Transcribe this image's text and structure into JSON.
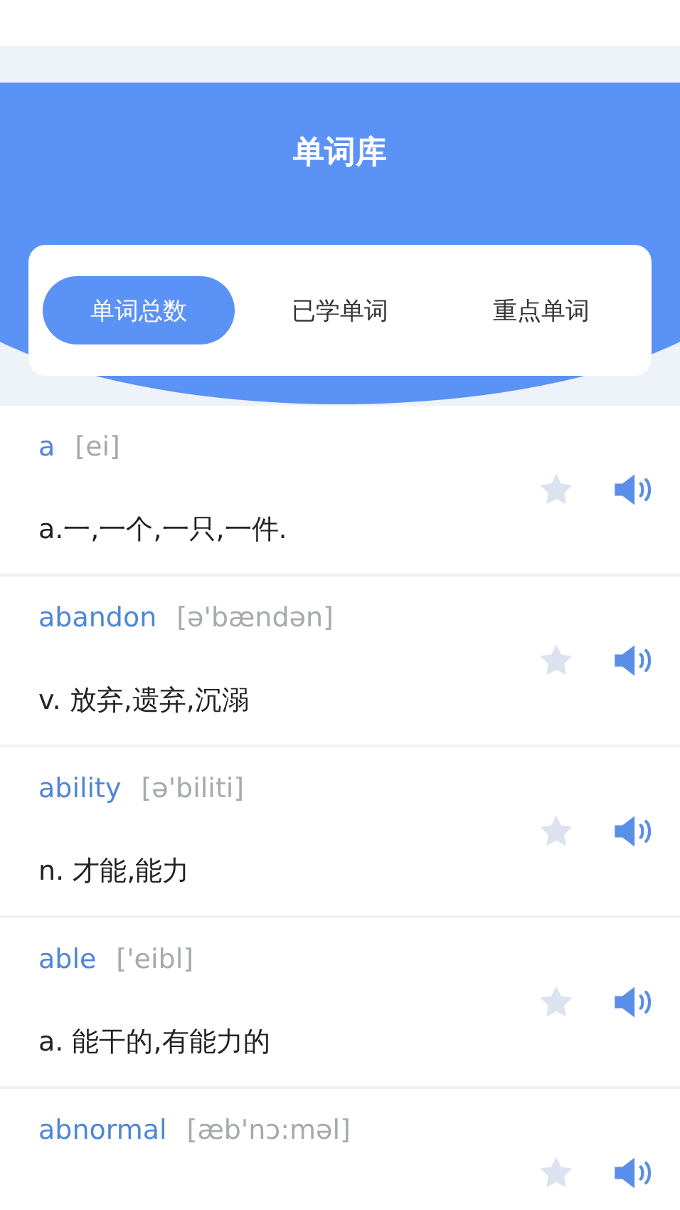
{
  "header": {
    "title": "单词库"
  },
  "tabs": [
    {
      "label": "单词总数",
      "selected": true
    },
    {
      "label": "已学单词",
      "selected": false
    },
    {
      "label": "重点单词",
      "selected": false
    }
  ],
  "words": [
    {
      "word": "a",
      "phonetic": "[ei]",
      "meaning": "a.一,一个,一只,一件.",
      "starred": false
    },
    {
      "word": "abandon",
      "phonetic": "[ə'bændən]",
      "meaning": "v. 放弃,遗弃,沉溺",
      "starred": false
    },
    {
      "word": "ability",
      "phonetic": "[ə'biliti]",
      "meaning": "n. 才能,能力",
      "starred": false
    },
    {
      "word": "able",
      "phonetic": "['eibl]",
      "meaning": "a. 能干的,有能力的",
      "starred": false
    },
    {
      "word": "abnormal",
      "phonetic": "[æb'nɔ:məl]",
      "starred": false
    }
  ]
}
